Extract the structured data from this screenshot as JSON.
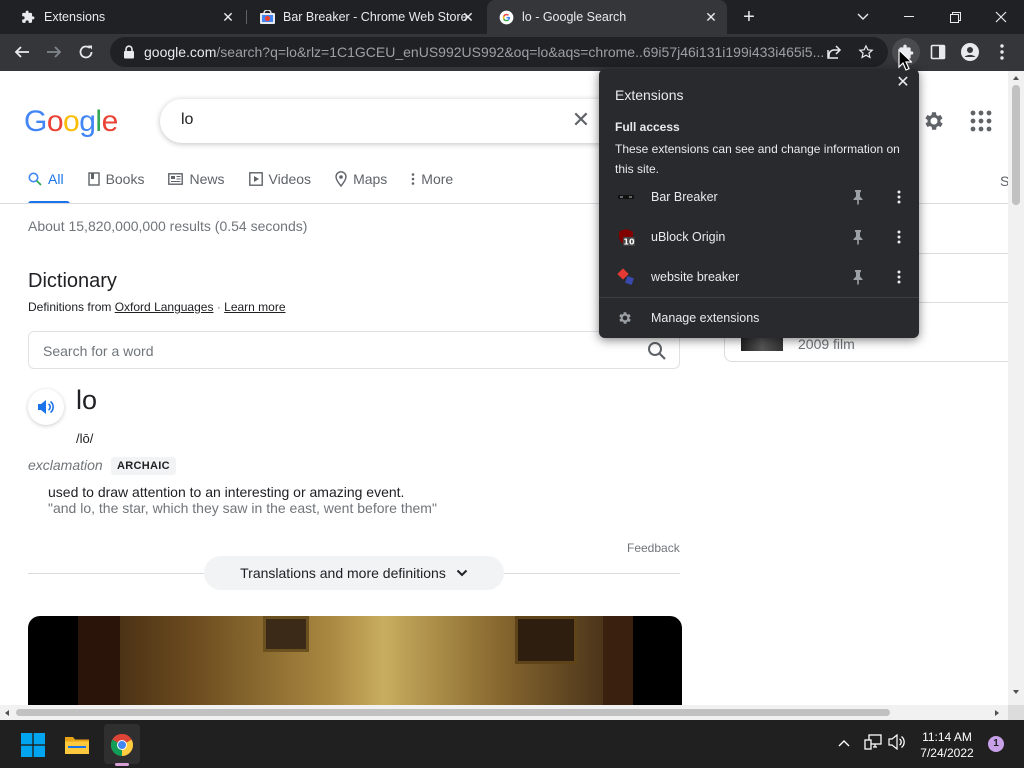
{
  "browser": {
    "tabs": [
      {
        "title": "Extensions",
        "active": false
      },
      {
        "title": "Bar Breaker - Chrome Web Store",
        "active": false
      },
      {
        "title": "lo - Google Search",
        "active": true
      }
    ],
    "url_host": "google.com",
    "url_rest": "/search?q=lo&rlz=1C1GCEU_enUS992US992&oq=lo&aqs=chrome..69i57j46i131i199i433i465i5..."
  },
  "google": {
    "logo": "Google",
    "query": "lo",
    "nav": [
      "All",
      "Books",
      "News",
      "Videos",
      "Maps",
      "More"
    ],
    "nav_s": "S",
    "stats": "About 15,820,000,000 results (0.54 seconds)"
  },
  "dictionary": {
    "title": "Dictionary",
    "source_prefix": "Definitions from",
    "source_link": "Oxford Languages",
    "separator": "·",
    "learn_more": "Learn more",
    "search_placeholder": "Search for a word",
    "word": "lo",
    "pronunciation": "/lō/",
    "part_of_speech": "exclamation",
    "badge": "ARCHAIC",
    "definition": "used to draw attention to an interesting or amazing event.",
    "example": "\"and lo, the star, which they saw in the east, went before them\"",
    "feedback": "Feedback",
    "more_button": "Translations and more definitions"
  },
  "knowledge_panel": {
    "film_label": "2009 film"
  },
  "extensions_popup": {
    "title": "Extensions",
    "access_heading": "Full access",
    "access_description": "These extensions can see and change information on this site.",
    "extensions": [
      {
        "name": "Bar Breaker"
      },
      {
        "name": "uBlock Origin",
        "badge": "10"
      },
      {
        "name": "website breaker"
      }
    ],
    "manage": "Manage extensions"
  },
  "taskbar": {
    "time": "11:14 AM",
    "date": "7/24/2022",
    "notification_count": "1"
  },
  "colors": {
    "google_blue": "#4285F4",
    "google_red": "#EA4335",
    "google_yellow": "#FBBC05",
    "google_green": "#34A853",
    "link_blue": "#1a73e8",
    "popup_bg": "#292a2d"
  }
}
